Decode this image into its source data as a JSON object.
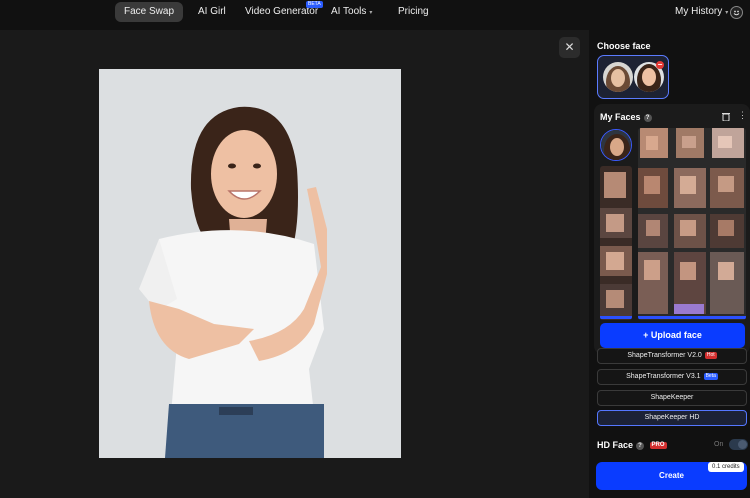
{
  "nav": {
    "items": [
      {
        "label": "Face Swap",
        "active": true
      },
      {
        "label": "AI Girl"
      },
      {
        "label": "Video Generator",
        "badge": "BETA"
      },
      {
        "label": "AI Tools"
      },
      {
        "label": "Pricing"
      }
    ],
    "history_label": "My History"
  },
  "viewer": {
    "close_glyph": "✕"
  },
  "panel": {
    "choose_face_title": "Choose face",
    "minus_glyph": "−",
    "my_faces_title": "My Faces",
    "help_glyph": "?",
    "upload_label": "+ Upload face",
    "models": [
      {
        "label": "ShapeTransformer V2.0",
        "tag": "Hot",
        "tag_color": "#d32f2f"
      },
      {
        "label": "ShapeTransformer V3.1",
        "tag": "Beta",
        "tag_color": "#2a5cff"
      },
      {
        "label": "ShapeKeeper"
      },
      {
        "label": "ShapeKeeper HD",
        "selected": true
      }
    ],
    "hd_face_label": "HD Face",
    "pro_badge": "PRO",
    "toggle_state_label": "On",
    "create_label": "Create",
    "credits_label": "0.1 credits"
  },
  "colors": {
    "accent": "#0a3cff",
    "hot": "#d32f2f",
    "beta": "#2a5cff"
  }
}
